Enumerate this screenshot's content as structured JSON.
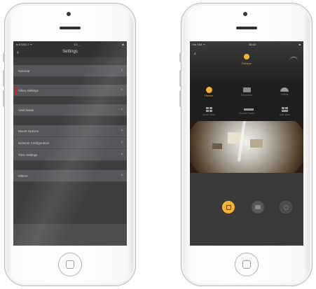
{
  "left_phone": {
    "status": {
      "carrier": "● ESSELT ᯤ",
      "time": "12:__",
      "battery": "■"
    },
    "nav": {
      "back": "‹",
      "title": "Settings"
    },
    "settings": [
      {
        "label": "General",
        "chevron": "›"
      },
      {
        "label": "Video Settings",
        "chevron": "›",
        "highlighted": true
      },
      {
        "label": "Vivid Mode",
        "chevron": "›"
      },
      {
        "label": "Mount Options",
        "chevron": "›"
      },
      {
        "label": "Network Configuration",
        "chevron": "›"
      },
      {
        "label": "Time Settings",
        "chevron": "›"
      },
      {
        "label": "Others",
        "chevron": "›"
      }
    ]
  },
  "right_phone": {
    "status": {
      "carrier": "No SIM ᯤ",
      "time": "08:48"
    },
    "back": "‹",
    "current_mode_label": "Fisheye",
    "modes": [
      {
        "label": "Fisheye",
        "icon": "fisheye-dot-icon",
        "active": true
      },
      {
        "label": "Panorama",
        "icon": "panorama-icon"
      },
      {
        "label": "Ceiling",
        "icon": "dome-icon"
      },
      {
        "label": "Quad View",
        "icon": "quad-view-icon"
      },
      {
        "label": "Double Panel",
        "icon": "double-panel-icon"
      },
      {
        "label": "Split View",
        "icon": "split-view-icon"
      }
    ],
    "controls": [
      {
        "icon": "record-icon",
        "active": true,
        "color": "#f4b334"
      },
      {
        "icon": "snapshot-icon"
      },
      {
        "icon": "settings-circle-icon"
      }
    ]
  }
}
